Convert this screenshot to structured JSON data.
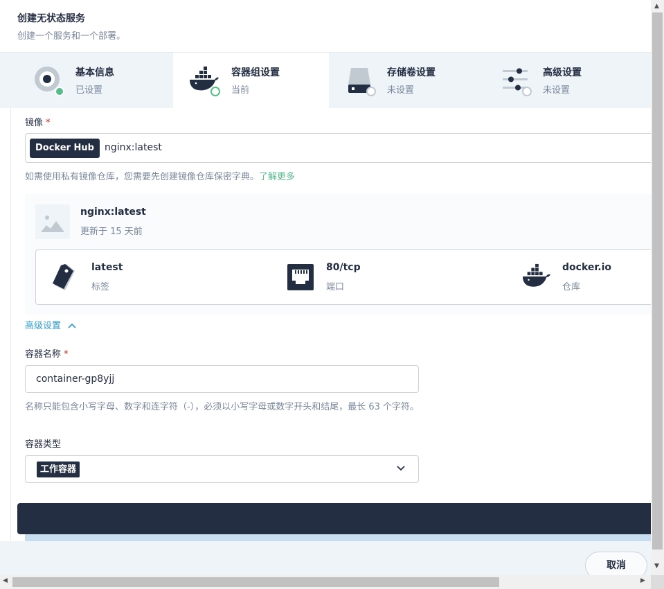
{
  "header": {
    "title": "创建无状态服务",
    "description": "创建一个服务和一个部署。"
  },
  "steps": [
    {
      "title": "基本信息",
      "status": "已设置",
      "icon": "basic-info-icon"
    },
    {
      "title": "容器组设置",
      "status": "当前",
      "icon": "docker-icon"
    },
    {
      "title": "存储卷设置",
      "status": "未设置",
      "icon": "storage-icon"
    },
    {
      "title": "高级设置",
      "status": "未设置",
      "icon": "sliders-icon"
    }
  ],
  "image": {
    "label": "镜像",
    "required_mark": "*",
    "registry": "Docker Hub",
    "value": "nginx:latest",
    "hint": "如需使用私有镜像仓库，您需要先创建镜像仓库保密字典。",
    "hint_link": "了解更多"
  },
  "image_card": {
    "name": "nginx:latest",
    "updated": "更新于 15 天前",
    "items": [
      {
        "value": "latest",
        "key": "标签",
        "icon": "tag-icon"
      },
      {
        "value": "80/tcp",
        "key": "端口",
        "icon": "ethernet-port-icon"
      },
      {
        "value": "docker.io",
        "key": "仓库",
        "icon": "docker-icon"
      }
    ]
  },
  "advanced": {
    "toggle_label": "高级设置"
  },
  "container_name": {
    "label": "容器名称",
    "required_mark": "*",
    "value": "container-gp8yjj",
    "hint": "名称只能包含小写字母、数字和连字符（-），必须以小写字母或数字开头和结尾，最长 63 个字符。"
  },
  "container_type": {
    "label": "容器类型",
    "selected": "工作容器"
  },
  "footer": {
    "cancel_label": "取消"
  },
  "colors": {
    "dark": "#242e42",
    "muted": "#79879c",
    "green": "#55bc8a",
    "link_blue": "#329dce",
    "panel_bg": "#eff4f9"
  }
}
